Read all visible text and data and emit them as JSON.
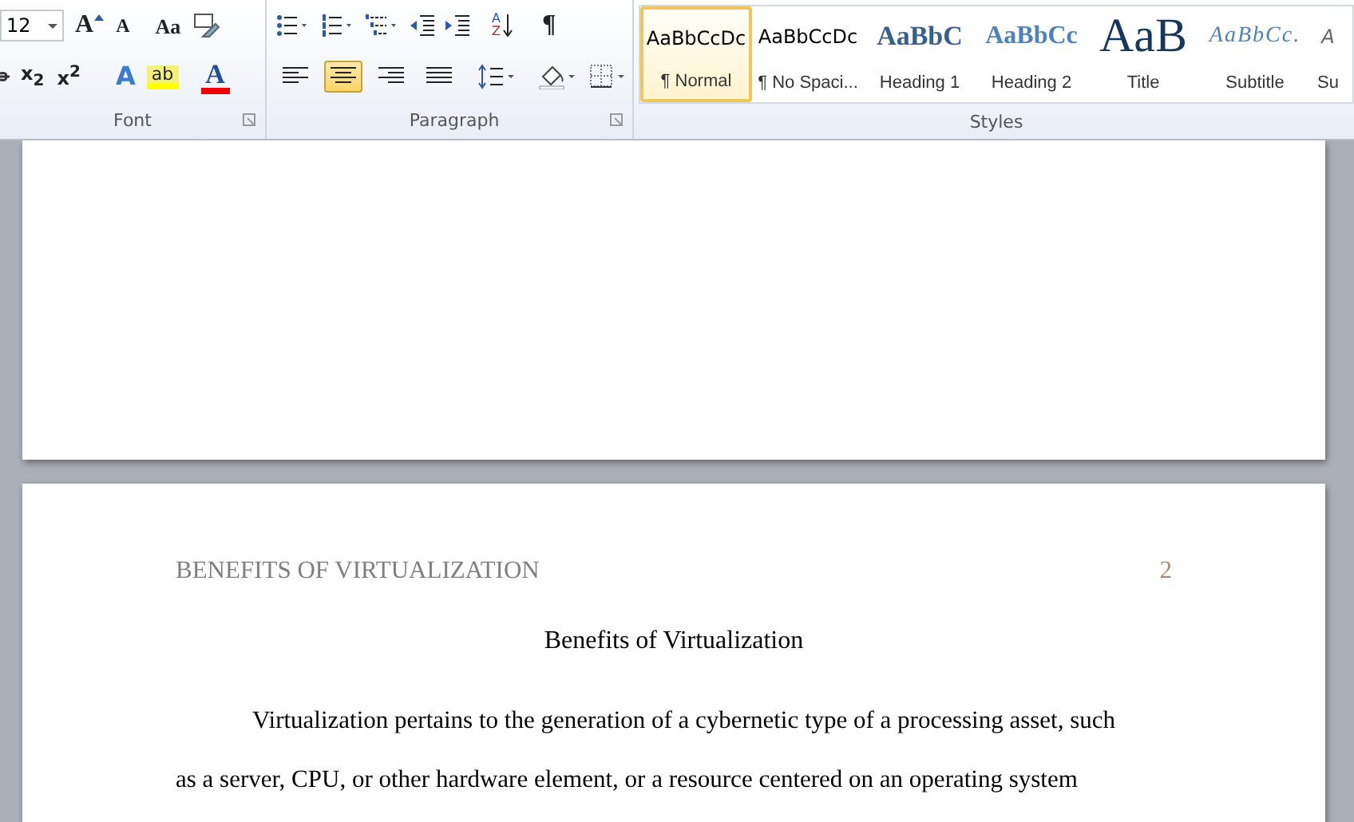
{
  "ribbon": {
    "font_group": {
      "label": "Font",
      "font_size": "12",
      "row_1": [
        {
          "kind": "grow",
          "glyph": "A"
        },
        {
          "kind": "shrink",
          "glyph": "A"
        },
        {
          "kind": "case",
          "glyph": "Aa"
        },
        {
          "kind": "clear"
        }
      ],
      "row_2": [
        {
          "kind": "strike"
        },
        {
          "kind": "sub",
          "glyph": "x$_{2}$"
        },
        {
          "kind": "sup",
          "glyph": "x$^{2}$"
        },
        {
          "kind": "effects",
          "glyph": "A"
        },
        {
          "kind": "highlight",
          "glyph": "ab"
        },
        {
          "kind": "color",
          "glyph": "A"
        }
      ]
    },
    "paragraph_group": {
      "label": "Paragraph",
      "row_1": [
        {
          "kind": "bullets"
        },
        {
          "kind": "numbering"
        },
        {
          "kind": "multilevel"
        },
        {
          "kind": "outdent"
        },
        {
          "kind": "indent"
        },
        {
          "kind": "sort",
          "glyph": "A",
          "glyph_2": "Z"
        },
        {
          "kind": "pilcrow",
          "glyph": "¶"
        }
      ],
      "alignment": [
        {
          "kind": "left",
          "selected": false
        },
        {
          "kind": "center",
          "selected": true
        },
        {
          "kind": "right",
          "selected": false
        },
        {
          "kind": "justify",
          "selected": false
        }
      ],
      "row_2": [
        {
          "kind": "spacing"
        },
        {
          "kind": "shading"
        },
        {
          "kind": "borders"
        }
      ]
    },
    "styles_group": {
      "label": "Styles",
      "styles": [
        {
          "kind": "normal",
          "preview": "AaBbCcDc",
          "label": "¶ Normal",
          "selected": true
        },
        {
          "kind": "nospacing",
          "preview": "AaBbCcDc",
          "label": "¶ No Spaci...",
          "selected": false
        },
        {
          "kind": "heading1",
          "preview": "AaBbC",
          "label": "Heading 1",
          "selected": false
        },
        {
          "kind": "heading2",
          "preview": "AaBbCc",
          "label": "Heading 2",
          "selected": false
        },
        {
          "kind": "title",
          "preview": "AaB",
          "label": "Title",
          "selected": false
        },
        {
          "kind": "subtitle",
          "preview": "AaBbCc.",
          "label": "Subtitle",
          "selected": false
        },
        {
          "kind": "subtle",
          "preview": "A",
          "label": "Su",
          "selected": false
        }
      ]
    }
  },
  "document": {
    "header": "BENEFITS OF VIRTUALIZATION",
    "page_number": "2",
    "title": "Benefits of Virtualization",
    "paragraph": [
      "Virtualization pertains to the generation of a cybernetic type of a processing asset, such",
      "as a server, CPU, or other hardware element, or a resource centered on an operating system"
    ]
  }
}
